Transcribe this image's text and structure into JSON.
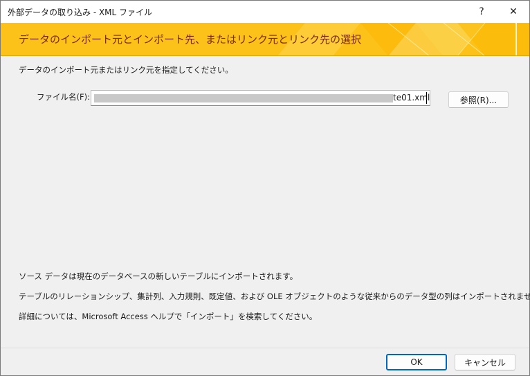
{
  "window": {
    "title": "外部データの取り込み - XML ファイル",
    "help_label": "?",
    "close_label": "✕"
  },
  "banner": {
    "heading": "データのインポート元とインポート先、またはリンク元とリンク先の選択",
    "color": "#fcc21a"
  },
  "content": {
    "instruction": "データのインポート元またはリンク元を指定してください。",
    "file_label": "ファイル名(F):",
    "file_value_visible": "te01.xml",
    "browse_label": "参照(R)...",
    "notes": [
      "ソース データは現在のデータベースの新しいテーブルにインポートされます。",
      "テーブルのリレーションシップ、集計列、入力規則、既定値、および OLE オブジェクトのような従来からのデータ型の列はインポートされません。",
      "詳細については、Microsoft Access ヘルプで「インポート」を検索してください。"
    ]
  },
  "footer": {
    "ok_label": "OK",
    "cancel_label": "キャンセル"
  }
}
